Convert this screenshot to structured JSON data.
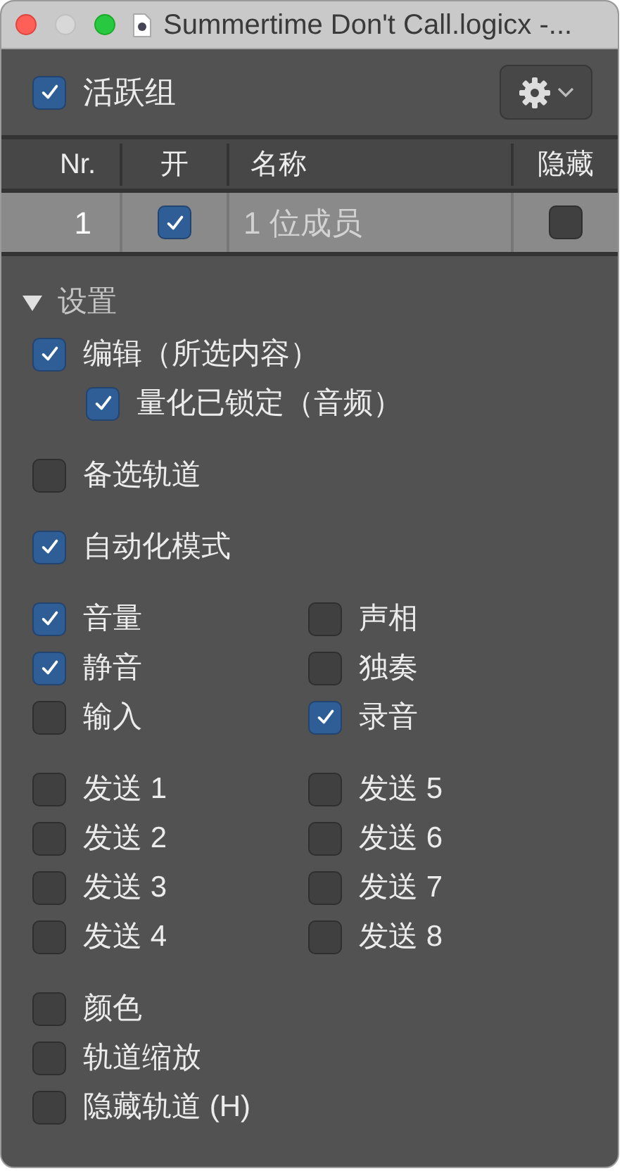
{
  "window": {
    "title": "Summertime Don't Call.logicx -..."
  },
  "group": {
    "label": "活跃组",
    "checked": true
  },
  "table": {
    "columns": [
      "Nr.",
      "开",
      "名称",
      "隐藏"
    ],
    "rows": [
      {
        "nr": "1",
        "on": true,
        "name_placeholder": "1 位成员",
        "hidden": false
      }
    ]
  },
  "settings": {
    "title": "设置",
    "expanded": true,
    "groups": [
      {
        "kind": "list",
        "items": [
          {
            "label": "编辑（所选内容）",
            "checked": true,
            "children": [
              {
                "label": "量化已锁定（音频）",
                "checked": true
              }
            ]
          }
        ]
      },
      {
        "kind": "list",
        "items": [
          {
            "label": "备选轨道",
            "checked": false
          }
        ]
      },
      {
        "kind": "list",
        "items": [
          {
            "label": "自动化模式",
            "checked": true
          }
        ]
      },
      {
        "kind": "grid",
        "items": [
          {
            "label": "音量",
            "checked": true
          },
          {
            "label": "声相",
            "checked": false
          },
          {
            "label": "静音",
            "checked": true
          },
          {
            "label": "独奏",
            "checked": false
          },
          {
            "label": "输入",
            "checked": false
          },
          {
            "label": "录音",
            "checked": true
          }
        ]
      },
      {
        "kind": "grid",
        "items": [
          {
            "label": "发送 1",
            "checked": false
          },
          {
            "label": "发送 5",
            "checked": false
          },
          {
            "label": "发送 2",
            "checked": false
          },
          {
            "label": "发送 6",
            "checked": false
          },
          {
            "label": "发送 3",
            "checked": false
          },
          {
            "label": "发送 7",
            "checked": false
          },
          {
            "label": "发送 4",
            "checked": false
          },
          {
            "label": "发送 8",
            "checked": false
          }
        ]
      },
      {
        "kind": "list",
        "items": [
          {
            "label": "颜色",
            "checked": false
          },
          {
            "label": "轨道缩放",
            "checked": false
          },
          {
            "label": "隐藏轨道 (H)",
            "checked": false
          }
        ]
      }
    ]
  }
}
